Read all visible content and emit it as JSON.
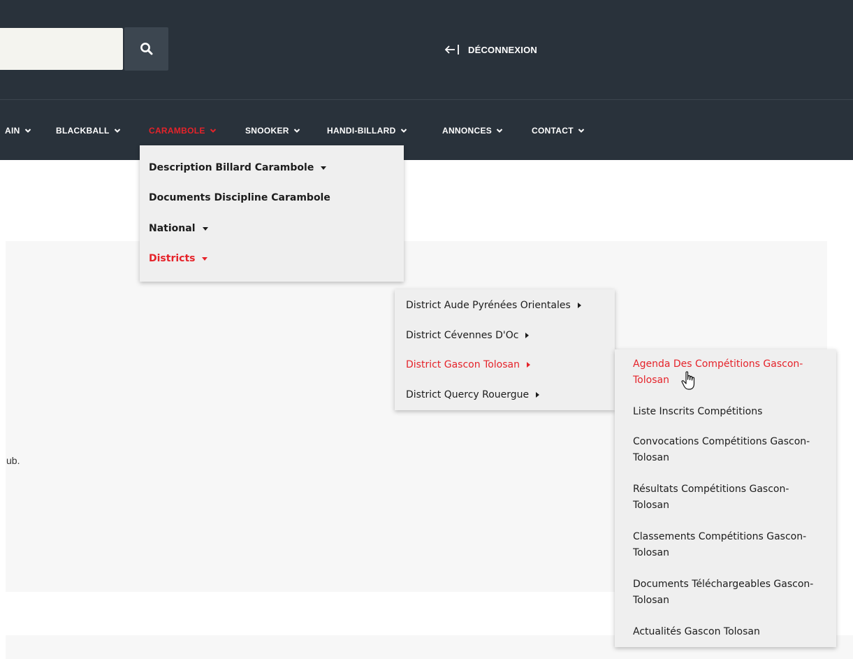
{
  "header": {
    "search": {
      "value": "",
      "placeholder": ""
    },
    "logout_label": "DÉCONNEXION"
  },
  "nav": {
    "items": [
      {
        "label": "AIN"
      },
      {
        "label": "BLACKBALL"
      },
      {
        "label": "CARAMBOLE"
      },
      {
        "label": "SNOOKER"
      },
      {
        "label": "HANDI-BILLARD"
      },
      {
        "label": "ANNONCES"
      },
      {
        "label": "CONTACT"
      }
    ],
    "active_color": "#e5232a"
  },
  "menu_carambole": {
    "items": [
      {
        "label": "Description Billard Carambole"
      },
      {
        "label": "Documents Discipline Carambole"
      },
      {
        "label": "National"
      },
      {
        "label": "Districts"
      }
    ]
  },
  "menu_districts": {
    "items": [
      {
        "label": "District Aude Pyrénées Orientales"
      },
      {
        "label": "District Cévennes D'Oc"
      },
      {
        "label": "District Gascon Tolosan"
      },
      {
        "label": "District Quercy Rouergue"
      }
    ]
  },
  "menu_gascon": {
    "items": [
      {
        "line1": "Agenda Des Compétitions Gascon-",
        "line2": "Tolosan"
      },
      {
        "line1": "Liste Inscrits Compétitions",
        "line2": ""
      },
      {
        "line1": "Convocations Compétitions Gascon-",
        "line2": "Tolosan"
      },
      {
        "line1": "Résultats Compétitions Gascon-",
        "line2": "Tolosan"
      },
      {
        "line1": "Classements Compétitions Gascon-",
        "line2": "Tolosan"
      },
      {
        "line1": "Documents Téléchargeables Gascon-",
        "line2": "Tolosan"
      },
      {
        "line1": "Actualités Gascon Tolosan",
        "line2": ""
      }
    ]
  },
  "content": {
    "fragment_text": "ub."
  }
}
